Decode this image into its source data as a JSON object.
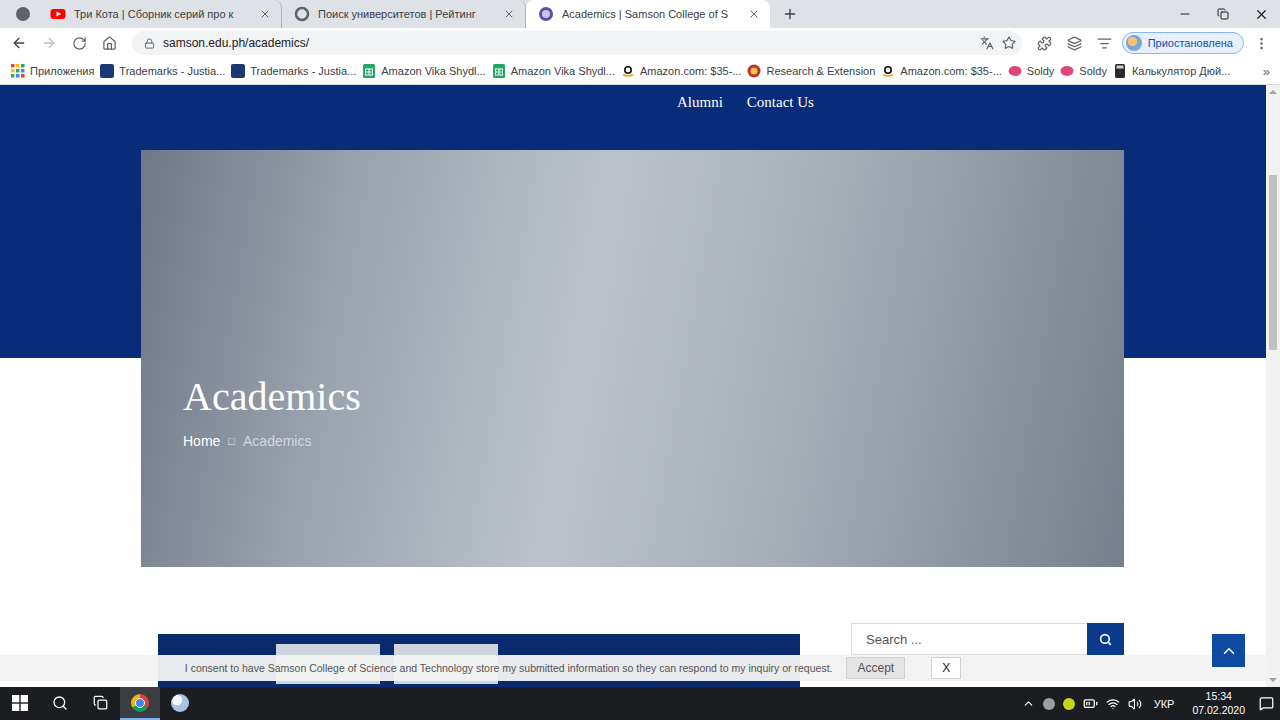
{
  "browser": {
    "tabs": [
      {
        "label": "Три Кота | Сборник серий про к",
        "kind": "youtube",
        "selected": false
      },
      {
        "label": "Поиск университетов | Рейтинг",
        "kind": "globe",
        "selected": false
      },
      {
        "label": "Academics | Samson College of S",
        "kind": "college",
        "selected": true
      }
    ],
    "address": "samson.edu.ph/academics/",
    "bookmarked": false,
    "profile": "Приостановлена",
    "bookmarks": [
      {
        "label": "Приложения",
        "kind": "apps"
      },
      {
        "label": "Trademarks - Justia...",
        "kind": "justia"
      },
      {
        "label": "Trademarks - Justia...",
        "kind": "justia"
      },
      {
        "label": "Amazon Vika Shydl...",
        "kind": "sheets"
      },
      {
        "label": "Amazon Vika Shydl...",
        "kind": "sheets"
      },
      {
        "label": "Amazon.com: $35-...",
        "kind": "amazon"
      },
      {
        "label": "Research & Extension",
        "kind": "research"
      },
      {
        "label": "Amazon.com: $35-...",
        "kind": "amazon"
      },
      {
        "label": "Soldy",
        "kind": "soldy"
      },
      {
        "label": "Soldy",
        "kind": "soldy"
      },
      {
        "label": "Калькулятор Дюй...",
        "kind": "calc"
      }
    ],
    "bookmarks_more": "»"
  },
  "page": {
    "nav": [
      {
        "label": "Alumni"
      },
      {
        "label": "Contact Us"
      }
    ],
    "hero": {
      "title": "Academics",
      "breadcrumb": [
        {
          "label": "Home",
          "current": false
        },
        {
          "label": "Academics",
          "current": true
        }
      ],
      "separator": "□"
    },
    "search": {
      "placeholder": "Search ..."
    },
    "cookie": {
      "text": "I consent to have Samson College of Science and Technology store my submitted information so they can respond to my inquiry or request.",
      "accept": "Accept",
      "close": "X"
    }
  },
  "taskbar": {
    "apps": [
      {
        "kind": "chrome",
        "selected": true
      },
      {
        "kind": "paint",
        "selected": false
      }
    ],
    "language": "УКР",
    "time": "15:34",
    "date": "07.02.2020"
  }
}
